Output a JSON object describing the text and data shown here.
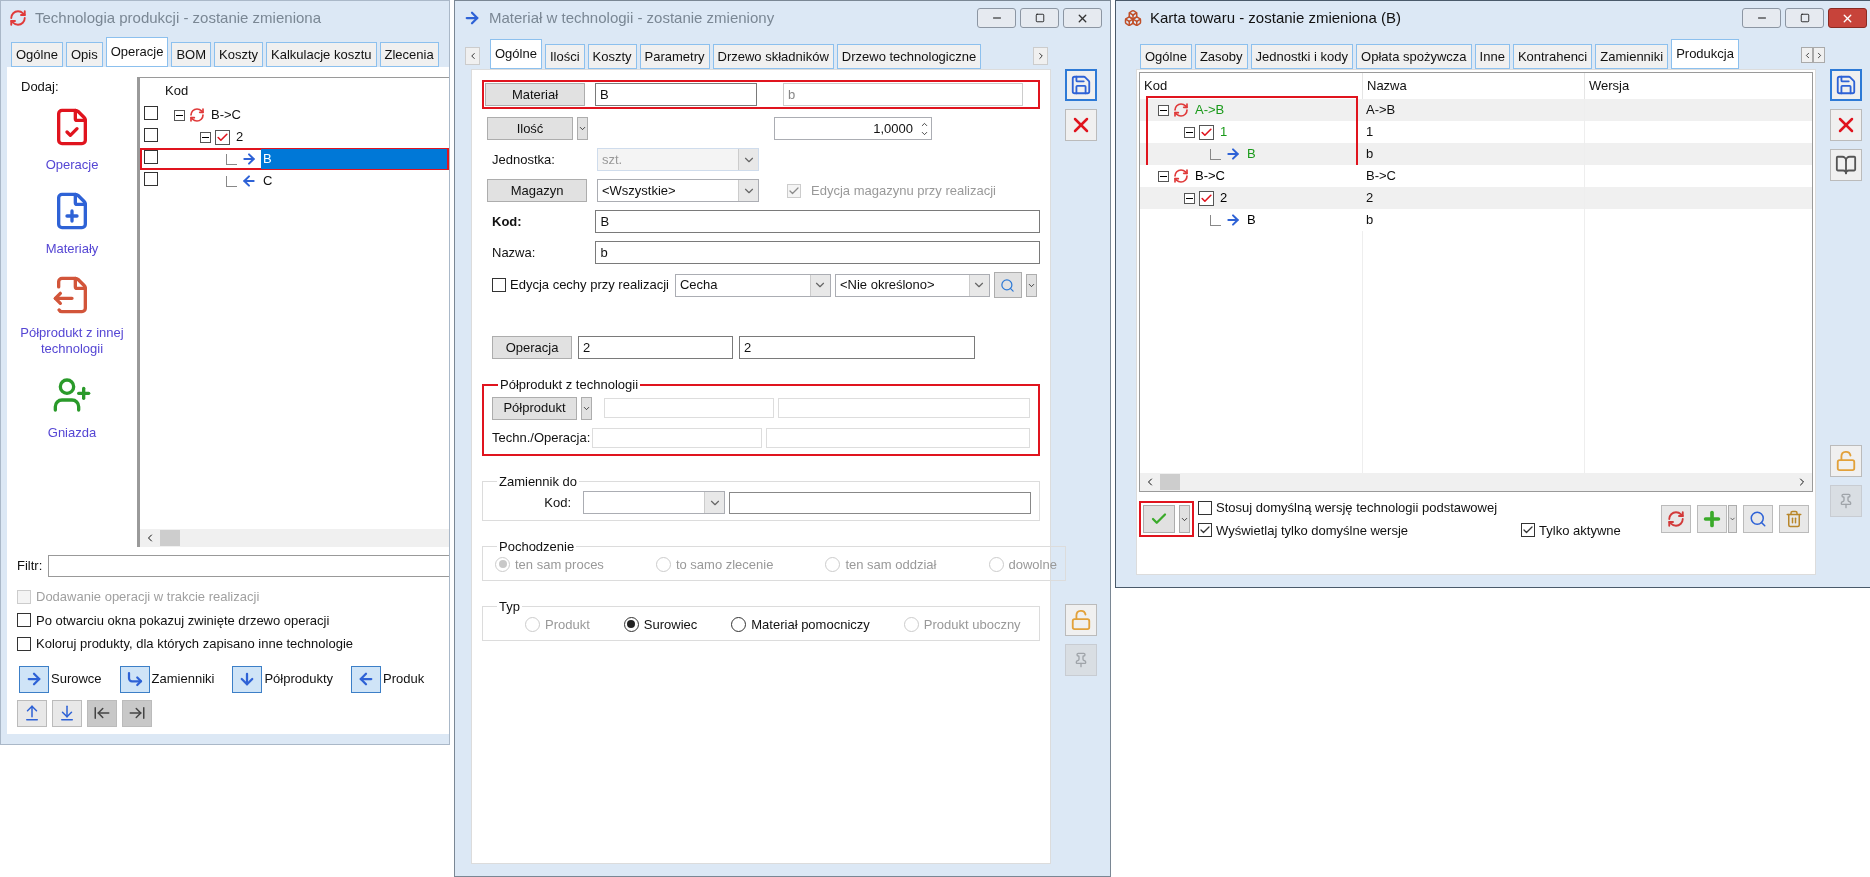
{
  "left_window": {
    "title": "Technologia produkcji - zostanie zmieniona",
    "tabs": [
      {
        "label": "Ogólne",
        "selected": false
      },
      {
        "label": "Opis",
        "selected": false
      },
      {
        "label": "Operacje",
        "selected": true
      },
      {
        "label": "BOM",
        "selected": false
      },
      {
        "label": "Koszty",
        "selected": false
      },
      {
        "label": "Kalkulacje kosztu",
        "selected": false
      },
      {
        "label": "Zlecenia",
        "selected": false
      }
    ],
    "add_label": "Dodaj:",
    "add_actions": [
      {
        "label": "Operacje",
        "kind": "operation"
      },
      {
        "label": "Materiały",
        "kind": "material"
      },
      {
        "label": "Półprodukt z innej technologii",
        "kind": "semi"
      },
      {
        "label": "Gniazda",
        "kind": "workcenter"
      }
    ],
    "tree": {
      "columns": [
        "Kod"
      ],
      "rows": [
        {
          "label": "B->C",
          "kind": "technology",
          "checked": false,
          "expanded": true,
          "selected": false,
          "highlighted": false,
          "children": [
            {
              "label": "2",
              "kind": "operation",
              "checked": false,
              "expanded": true,
              "selected": false,
              "highlighted": false,
              "children": [
                {
                  "label": "B",
                  "kind": "input",
                  "checked": false,
                  "selected": true,
                  "highlighted": true
                },
                {
                  "label": "C",
                  "kind": "output",
                  "checked": false,
                  "selected": false,
                  "highlighted": false
                }
              ]
            }
          ]
        }
      ]
    },
    "filter": {
      "label": "Filtr:"
    },
    "options": [
      {
        "label": "Dodawanie operacji w trakcie realizacji",
        "checked": false,
        "disabled": true
      },
      {
        "label": "Po otwarciu okna pokazuj zwinięte drzewo operacji",
        "checked": false,
        "disabled": false
      },
      {
        "label": "Koloruj produkty, dla których zapisano inne technologie",
        "checked": false,
        "disabled": false
      }
    ],
    "legend": [
      {
        "label": "Surowce",
        "kind": "input"
      },
      {
        "label": "Zamienniki",
        "kind": "substitute"
      },
      {
        "label": "Półprodukty",
        "kind": "semi"
      },
      {
        "label": "Produk",
        "kind": "output"
      }
    ],
    "toolbar": [
      {
        "kind": "move_up",
        "disabled": false
      },
      {
        "kind": "move_down",
        "disabled": false
      },
      {
        "kind": "move_left",
        "disabled": true
      },
      {
        "kind": "move_right",
        "disabled": true
      }
    ]
  },
  "middle_window": {
    "title": "Materiał w technologii - zostanie zmieniony",
    "tabs": [
      {
        "label": "Ogólne",
        "selected": true
      },
      {
        "label": "Ilości",
        "selected": false
      },
      {
        "label": "Koszty",
        "selected": false
      },
      {
        "label": "Parametry",
        "selected": false
      },
      {
        "label": "Drzewo składników",
        "selected": false
      },
      {
        "label": "Drzewo technologiczne",
        "selected": false
      }
    ],
    "material": {
      "button": "Materiał",
      "code": "B",
      "name": "b",
      "highlighted": true
    },
    "quantity": {
      "button": "Ilość",
      "value": "1,0000"
    },
    "unit": {
      "label": "Jednostka:",
      "value": "szt.",
      "disabled": true
    },
    "warehouse": {
      "button": "Magazyn",
      "value": "<Wszystkie>",
      "option": {
        "label": "Edycja magazynu przy realizacji",
        "checked": true,
        "disabled": true
      }
    },
    "code": {
      "label": "Kod:",
      "value": "B"
    },
    "name": {
      "label": "Nazwa:",
      "value": "b"
    },
    "feature": {
      "option": {
        "label": "Edycja cechy przy realizacji",
        "checked": false
      },
      "feature": "Cecha",
      "value": "<Nie określono>"
    },
    "operation": {
      "button": "Operacja",
      "code": "2",
      "name": "2"
    },
    "semi_product": {
      "title": "Półprodukt z technologii",
      "button": "Półprodukt",
      "row_label": "Techn./Operacja:",
      "highlighted": true
    },
    "substitute": {
      "title": "Zamiennik do",
      "label": "Kod:"
    },
    "origin": {
      "title": "Pochodzenie",
      "options": [
        {
          "label": "ten sam proces",
          "selected": true,
          "disabled": true
        },
        {
          "label": "to samo zlecenie",
          "selected": false,
          "disabled": true
        },
        {
          "label": "ten sam oddział",
          "selected": false,
          "disabled": true
        },
        {
          "label": "dowolne",
          "selected": false,
          "disabled": true
        }
      ]
    },
    "type": {
      "title": "Typ",
      "options": [
        {
          "label": "Produkt",
          "selected": false,
          "disabled": true
        },
        {
          "label": "Surowiec",
          "selected": true,
          "disabled": false
        },
        {
          "label": "Materiał pomocniczy",
          "selected": false,
          "disabled": false
        },
        {
          "label": "Produkt uboczny",
          "selected": false,
          "disabled": true
        }
      ]
    },
    "side_tools": [
      {
        "kind": "save",
        "disabled": false
      },
      {
        "kind": "cancel",
        "disabled": false
      },
      {
        "kind": "unlock",
        "disabled": false
      },
      {
        "kind": "pin",
        "disabled": true
      }
    ]
  },
  "right_window": {
    "title": "Karta towaru - zostanie zmieniona (B)",
    "tabs": [
      {
        "label": "Ogólne",
        "selected": false
      },
      {
        "label": "Zasoby",
        "selected": false
      },
      {
        "label": "Jednostki i kody",
        "selected": false
      },
      {
        "label": "Opłata spożywcza",
        "selected": false
      },
      {
        "label": "Inne",
        "selected": false
      },
      {
        "label": "Kontrahenci",
        "selected": false
      },
      {
        "label": "Zamienniki",
        "selected": false
      },
      {
        "label": "Produkcja",
        "selected": true
      }
    ],
    "tree": {
      "columns": [
        "Kod",
        "Nazwa",
        "Wersja"
      ],
      "rows": [
        {
          "code": "A->B",
          "name": "A->B",
          "kind": "technology",
          "color": "#1a9a1a",
          "expanded": true,
          "highlighted": true,
          "children": [
            {
              "code": "1",
              "name": "1",
              "kind": "operation",
              "color": "#1a9a1a",
              "expanded": true,
              "children": [
                {
                  "code": "B",
                  "name": "b",
                  "kind": "input",
                  "color": "#1a9a1a"
                }
              ]
            }
          ]
        },
        {
          "code": "B->C",
          "name": "B->C",
          "kind": "technology",
          "color": "#000000",
          "expanded": true,
          "highlighted": false,
          "children": [
            {
              "code": "2",
              "name": "2",
              "kind": "operation",
              "color": "#000000",
              "expanded": true,
              "children": [
                {
                  "code": "B",
                  "name": "b",
                  "kind": "input",
                  "color": "#000000"
                }
              ]
            }
          ]
        }
      ]
    },
    "accept": {
      "highlighted": true
    },
    "options": [
      {
        "label": "Stosuj domyślną wersję technologii podstawowej",
        "checked": false
      },
      {
        "label": "Wyświetlaj tylko domyślne wersje",
        "checked": true
      },
      {
        "label": "Tylko aktywne",
        "checked": true
      }
    ],
    "tools": [
      {
        "kind": "refresh",
        "disabled": false
      },
      {
        "kind": "add",
        "disabled": false
      },
      {
        "kind": "search",
        "disabled": false
      },
      {
        "kind": "delete",
        "disabled": false
      }
    ],
    "side_tools": [
      {
        "kind": "save",
        "disabled": false
      },
      {
        "kind": "cancel",
        "disabled": false
      },
      {
        "kind": "book",
        "disabled": false
      },
      {
        "kind": "unlock",
        "disabled": false
      },
      {
        "kind": "pin",
        "disabled": true
      }
    ]
  }
}
